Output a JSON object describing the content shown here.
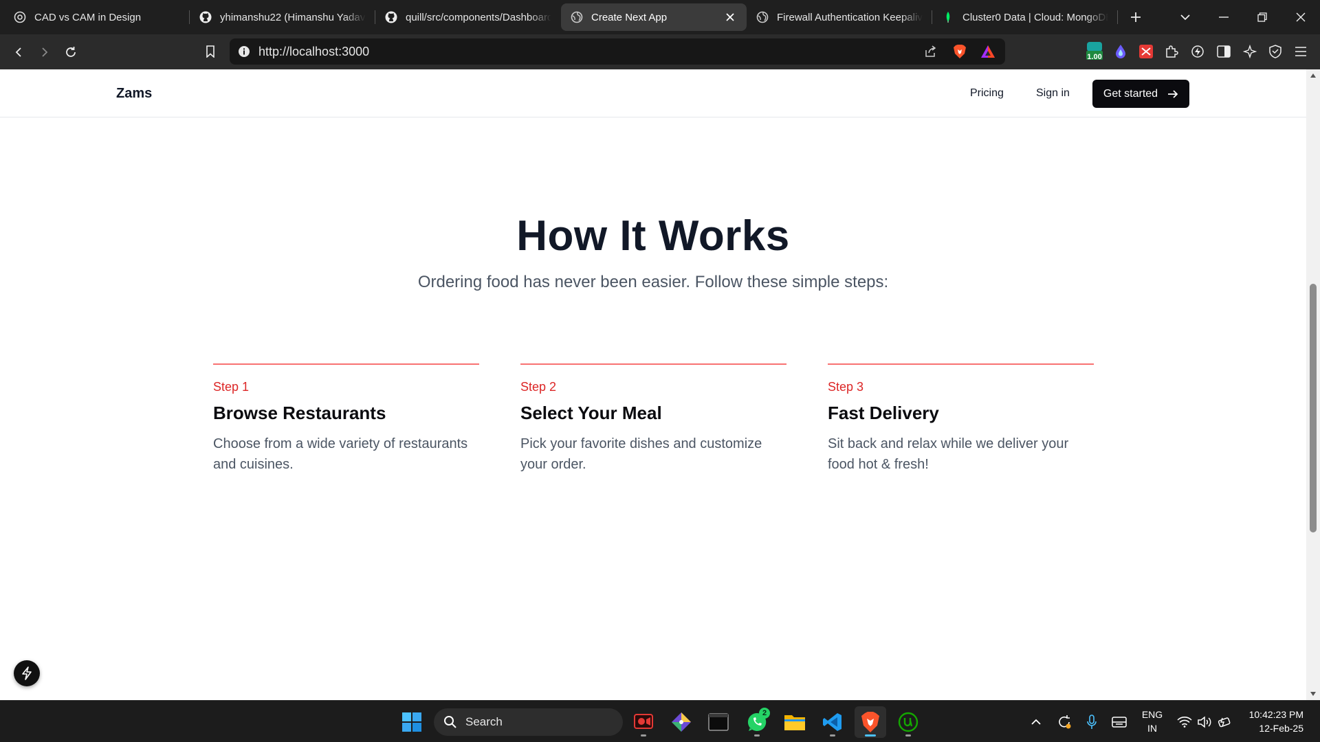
{
  "browser": {
    "tabs": [
      {
        "title": "CAD vs CAM in Design",
        "icon": "chatgpt-icon",
        "active": false
      },
      {
        "title": "yhimanshu22 (Himanshu Yadav)",
        "icon": "github-icon",
        "active": false
      },
      {
        "title": "quill/src/components/Dashboard",
        "icon": "github-icon",
        "active": false
      },
      {
        "title": "Create Next App",
        "icon": "globe-icon",
        "active": true
      },
      {
        "title": "Firewall Authentication Keepalive",
        "icon": "globe-icon",
        "active": false
      },
      {
        "title": "Cluster0 Data | Cloud: MongoDB",
        "icon": "mongodb-leaf-icon",
        "active": false
      }
    ],
    "url": "http://localhost:3000",
    "extension_badge": "1.00"
  },
  "site": {
    "brand": "Zams",
    "nav": {
      "pricing": "Pricing",
      "sign_in": "Sign in",
      "cta": "Get started"
    }
  },
  "hero": {
    "title": "How It Works",
    "subtitle": "Ordering food has never been easier. Follow these simple steps:"
  },
  "steps": [
    {
      "label": "Step 1",
      "title": "Browse Restaurants",
      "description": "Choose from a wide variety of restaurants and cuisines."
    },
    {
      "label": "Step 2",
      "title": "Select Your Meal",
      "description": "Pick your favorite dishes and customize your order."
    },
    {
      "label": "Step 3",
      "title": "Fast Delivery",
      "description": "Sit back and relax while we deliver your food hot & fresh!"
    }
  ],
  "taskbar": {
    "search_placeholder": "Search",
    "whatsapp_badge": "2",
    "language": "ENG",
    "region": "IN",
    "time": "10:42:23 PM",
    "date": "12-Feb-25"
  },
  "colors": {
    "accent": "#dc2626",
    "accent_line": "#f87171",
    "cta_bg": "#0b0b0f",
    "heading": "#111827",
    "muted": "#4b5563"
  }
}
